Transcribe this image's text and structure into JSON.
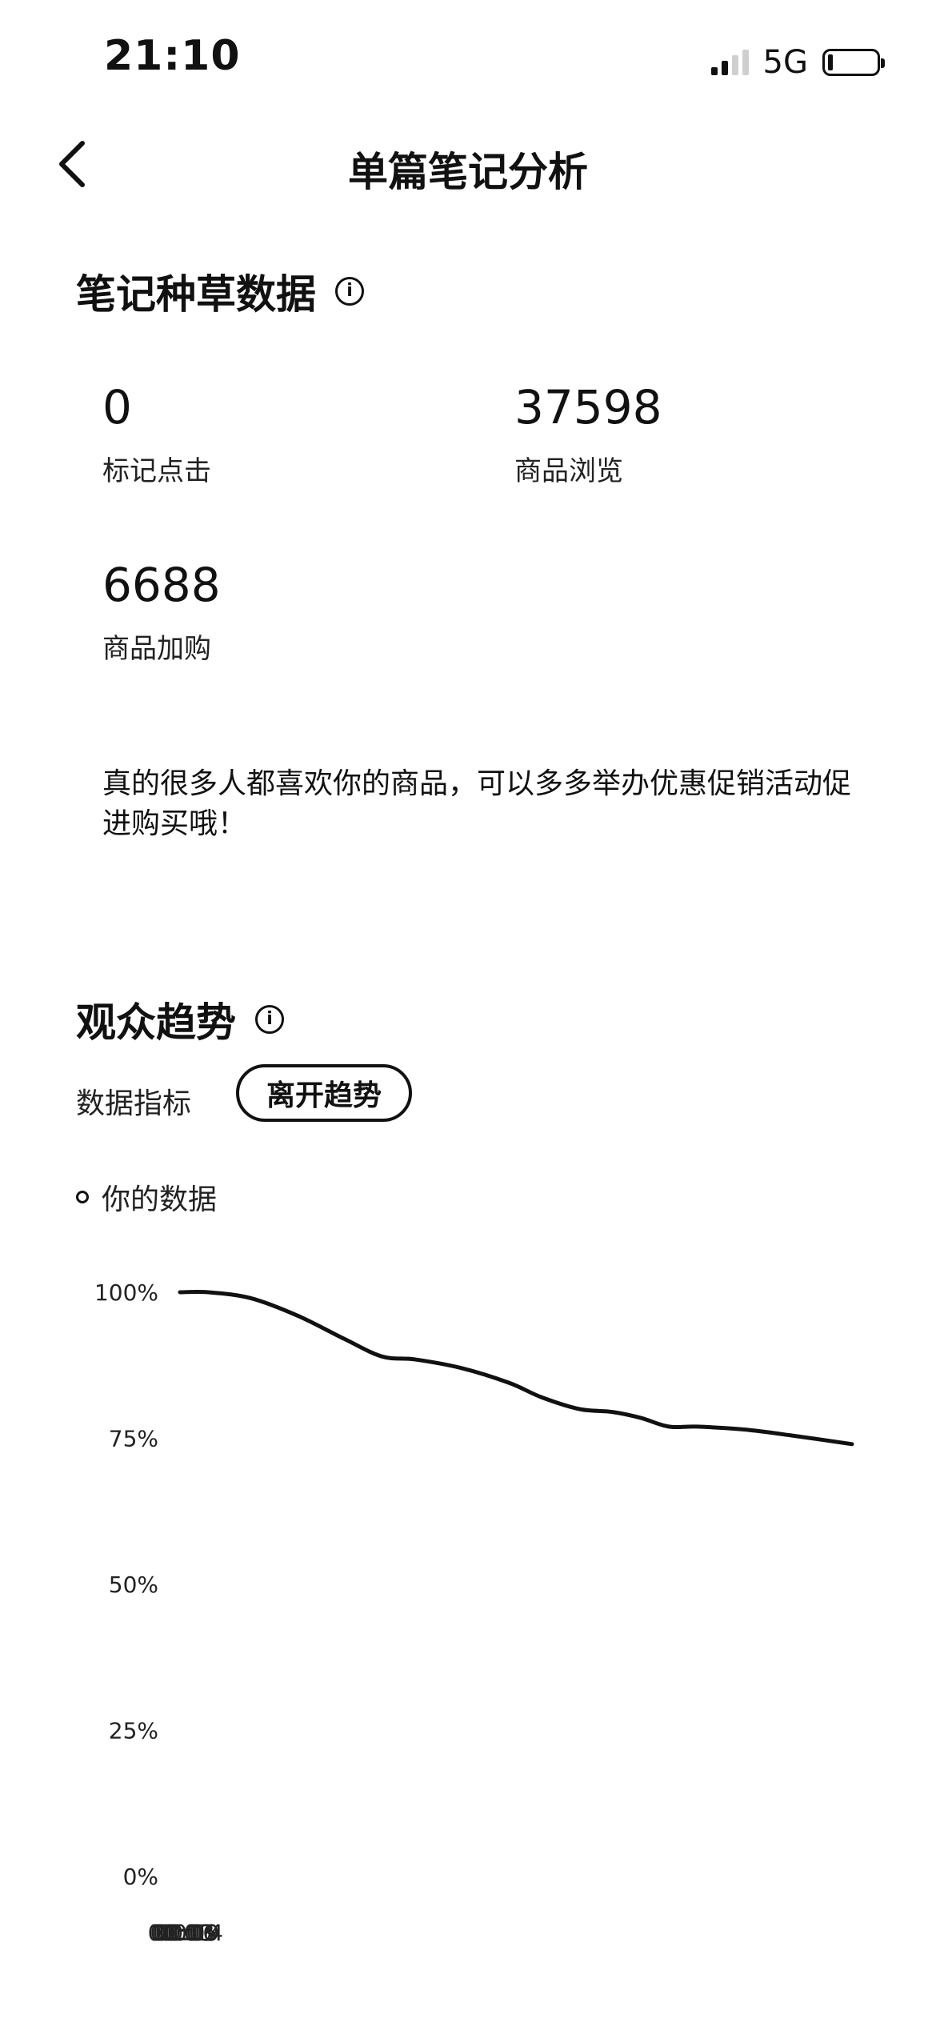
{
  "status_bar": {
    "time": "21:10",
    "network": "5G"
  },
  "nav": {
    "back_icon": "chevron-left-icon",
    "title": "单篇笔记分析"
  },
  "note_data": {
    "title": "笔记种草数据",
    "info_icon": "info-icon",
    "stats": [
      {
        "value": "0",
        "label": "标记点击"
      },
      {
        "value": "37598",
        "label": "商品浏览"
      },
      {
        "value": "6688",
        "label": "商品加购"
      }
    ],
    "tip": "真的很多人都喜欢你的商品，可以多多举办优惠促销活动促进购买哦！"
  },
  "audience": {
    "title": "观众趋势",
    "info_icon": "info-icon",
    "metric_label": "数据指标",
    "metric_selected": "离开趋势",
    "legend": "你的数据"
  },
  "chart_data": {
    "type": "line",
    "title": "",
    "xlabel": "",
    "ylabel": "",
    "x_ticks": [
      "00:00",
      "00:03",
      "00:06",
      "00:09",
      "00:14"
    ],
    "y_ticks": [
      "0%",
      "25%",
      "50%",
      "75%",
      "100%"
    ],
    "ylim": [
      0,
      100
    ],
    "xlim": [
      0,
      14.3
    ],
    "grid": false,
    "legend_position": "top-left",
    "series": [
      {
        "name": "你的数据",
        "color": "#111111",
        "x": [
          0,
          0.6,
          1.5,
          2.5,
          3.5,
          4.3,
          5,
          6,
          7,
          7.7,
          8.5,
          9.2,
          9.8,
          10.4,
          11,
          12,
          13,
          14.3
        ],
        "y": [
          100,
          100,
          99,
          96,
          92,
          89,
          88.5,
          87,
          84.5,
          82,
          80,
          79.5,
          78.5,
          77,
          77,
          76.5,
          75.5,
          74
        ]
      }
    ]
  }
}
